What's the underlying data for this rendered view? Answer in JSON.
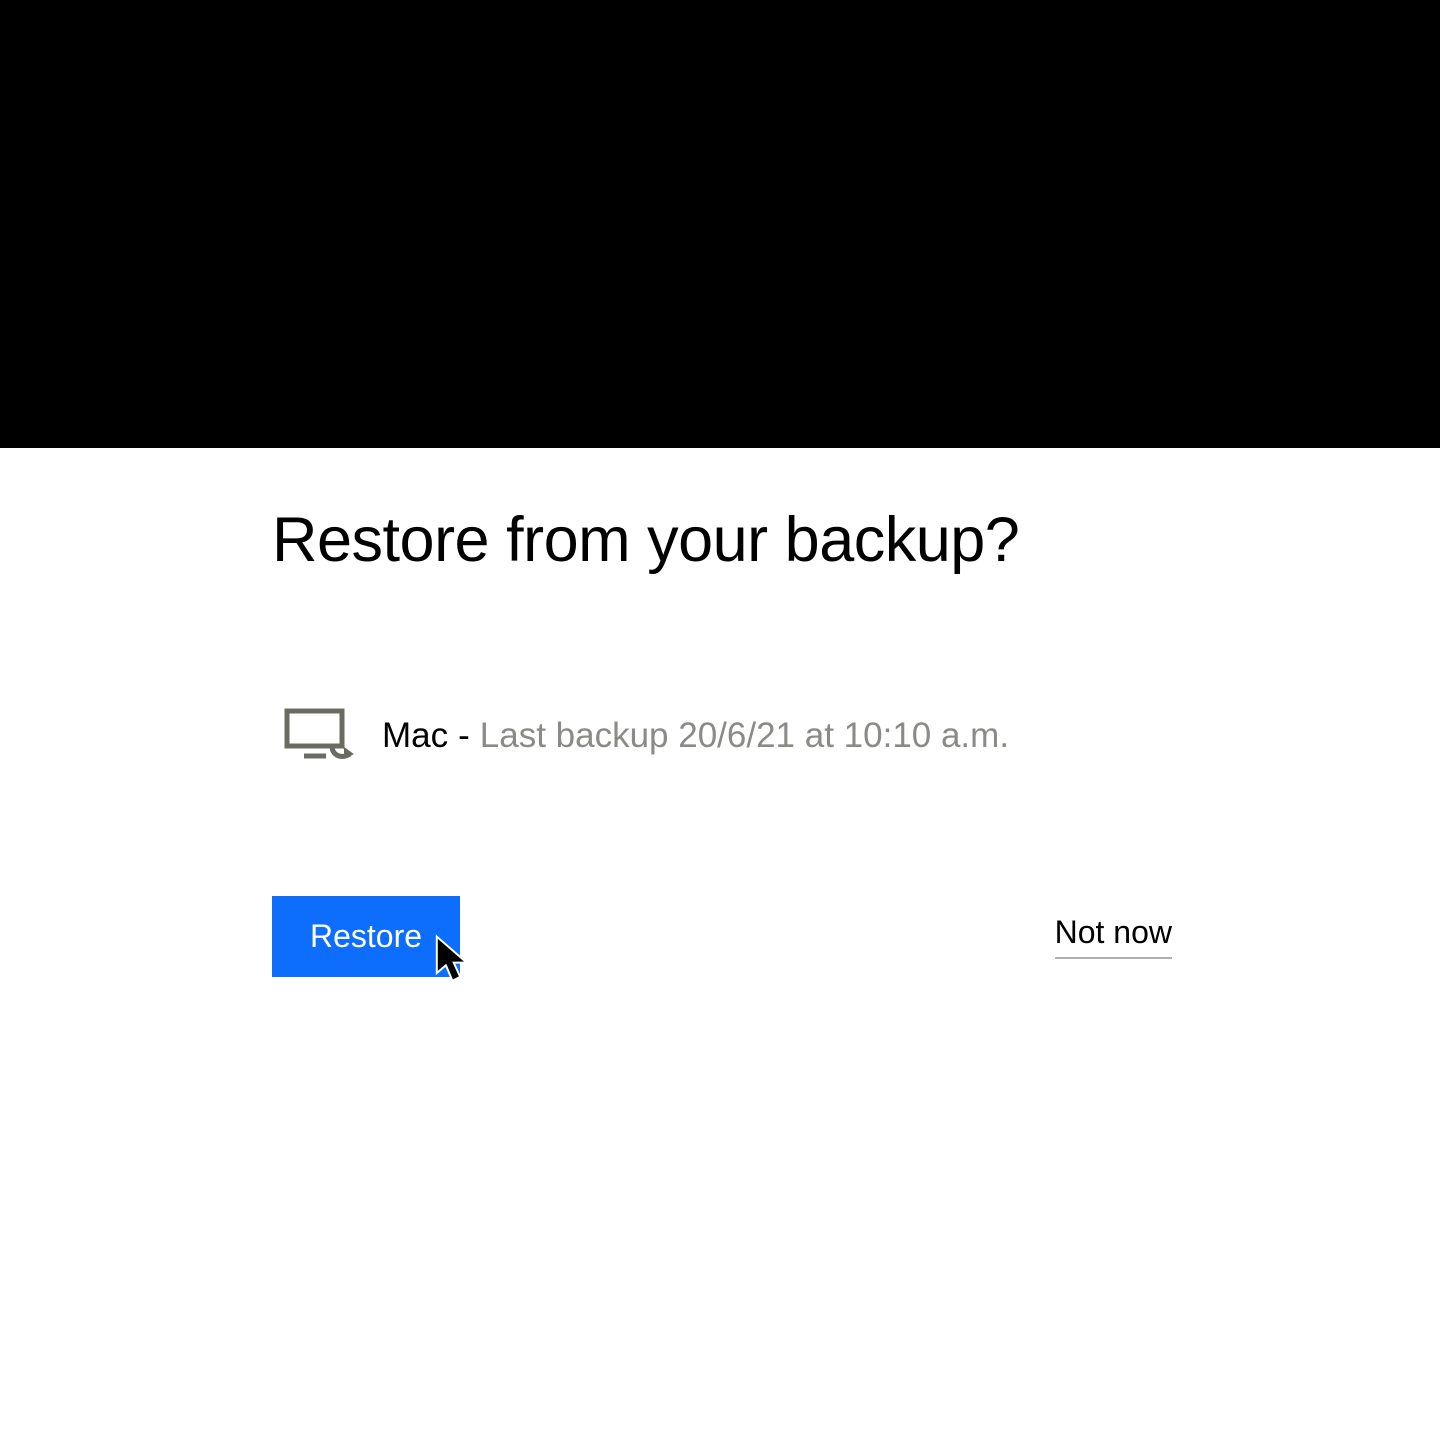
{
  "dialog": {
    "title": "Restore from your backup?",
    "device_name": "Mac",
    "separator": "-",
    "backup_detail": "Last backup 20/6/21 at 10:10 a.m.",
    "restore_label": "Restore",
    "not_now_label": "Not now"
  },
  "colors": {
    "primary": "#0d6efd",
    "muted": "#8a8a86"
  }
}
